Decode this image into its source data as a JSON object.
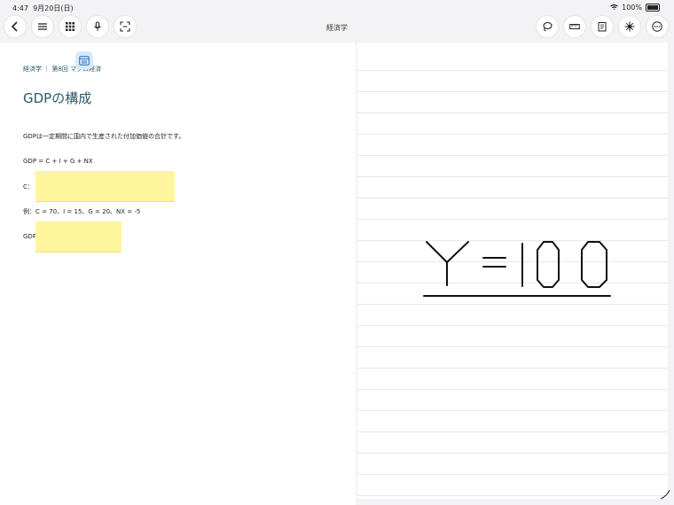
{
  "status": {
    "time": "4:47",
    "date": "9月20日(日)",
    "battery": "100%"
  },
  "toolbar": {
    "title": "経済学"
  },
  "page": {
    "number": ""
  },
  "document": {
    "breadcrumb": "経済学 ｜ 第8回 マクロ経済",
    "heading": "GDPの構成",
    "definition": "GDPは一定期間に国内で生産された付加価値の合計です。",
    "formula": "GDP = C + I + G + NX",
    "c_label": "C：",
    "example": "例：C = 70、I = 15、G = 20、NX = -5",
    "gdp_label": "GDP"
  },
  "handwriting": {
    "text": "Y=100"
  },
  "colors": {
    "accent": "#2a5b6b",
    "sticky": "#fff59d"
  }
}
